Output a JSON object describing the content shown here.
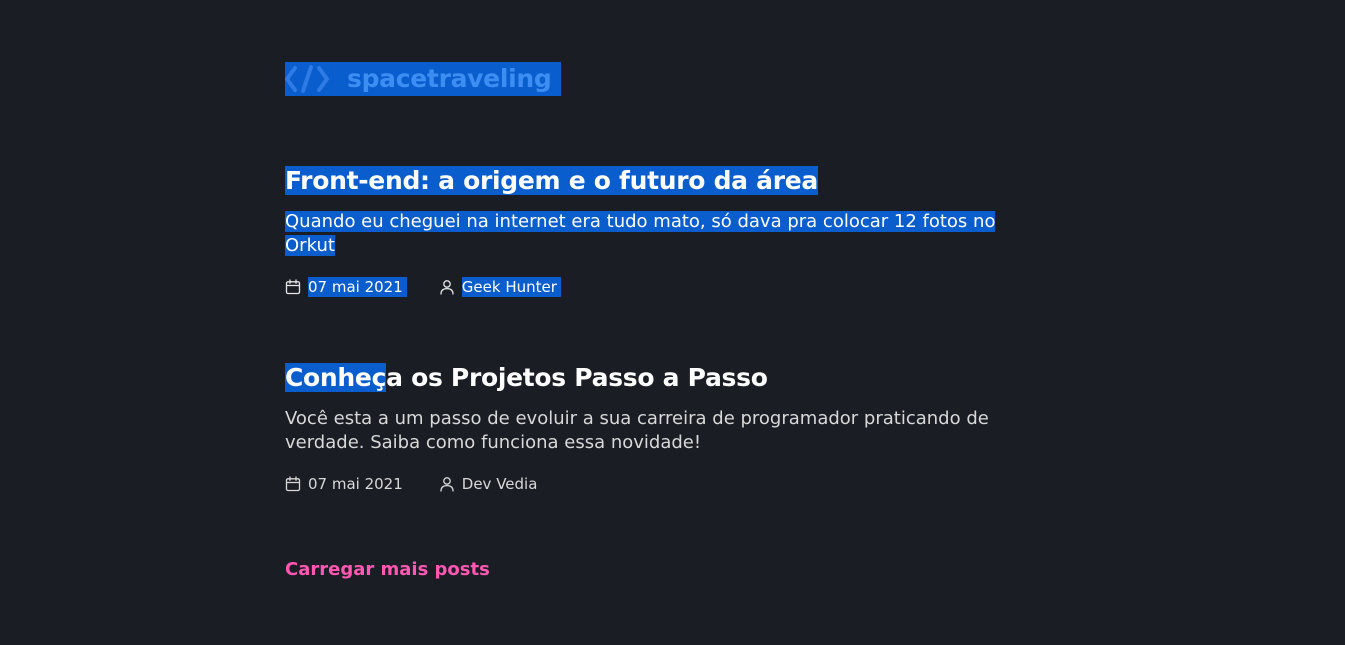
{
  "header": {
    "logo_text": "spacetraveling",
    "logo_icon": "code-brackets-icon",
    "brand_color": "#3d8ef2"
  },
  "posts": [
    {
      "title": "Front-end: a origem e o futuro da área",
      "subtitle": "Quando eu cheguei na internet era tudo mato, só dava pra colocar 12 fotos no Orkut",
      "date": "07 mai 2021",
      "author": "Geek Hunter",
      "date_icon": "calendar-icon",
      "author_icon": "user-icon"
    },
    {
      "title_selected": "Conheç",
      "title_rest": "a os Projetos Passo a Passo",
      "subtitle": "Você esta a um passo de evoluir a sua carreira de programador praticando de verdade. Saiba como funciona essa novidade!",
      "date": "07 mai 2021",
      "author": "Dev Vedia",
      "date_icon": "calendar-icon",
      "author_icon": "user-icon"
    }
  ],
  "load_more_label": "Carregar mais posts",
  "colors": {
    "background": "#1a1d24",
    "selection": "#0a5dcc",
    "accent_pink": "#ff57b2"
  }
}
